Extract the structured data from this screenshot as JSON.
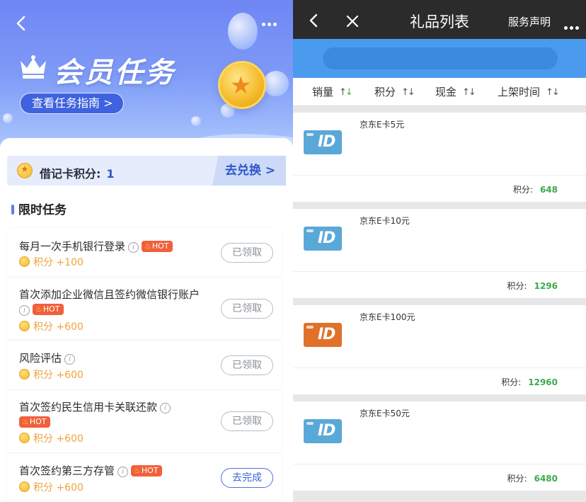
{
  "left": {
    "title": "会员任务",
    "guide_label": "查看任务指南 >",
    "points": {
      "label": "借记卡积分:",
      "value": "1",
      "exchange_label": "去兑换 >"
    },
    "section_title": "限时任务",
    "tasks": [
      {
        "name": "每月一次手机银行登录",
        "hot": "HOT",
        "reward": "积分 +100",
        "button": "已领取",
        "done": true
      },
      {
        "name": "首次添加企业微信且签约微信银行账户",
        "hot": "HOT",
        "reward": "积分 +600",
        "button": "已领取",
        "done": true
      },
      {
        "name": "风险评估",
        "hot": "",
        "reward": "积分 +600",
        "button": "已领取",
        "done": true
      },
      {
        "name": "首次签约民生信用卡关联还款",
        "hot": "HOT",
        "reward": "积分 +600",
        "button": "已领取",
        "done": true
      },
      {
        "name": "首次签约第三方存管",
        "hot": "HOT",
        "reward": "积分 +600",
        "button": "去完成",
        "done": false
      }
    ],
    "colors": {
      "accent": "#3f63de",
      "hot": "#f0603a",
      "reward": "#f0a23a"
    }
  },
  "right": {
    "title": "礼品列表",
    "declaration": "服务声明",
    "sort": [
      "销量",
      "积分",
      "现金",
      "上架时间"
    ],
    "price_label": "积分:",
    "gifts": [
      {
        "name": "京东E卡5元",
        "points": "648",
        "card_color": "#5aa8d8"
      },
      {
        "name": "京东E卡10元",
        "points": "1296",
        "card_color": "#5aa8d8"
      },
      {
        "name": "京东E卡100元",
        "points": "12960",
        "card_color": "#e0702a"
      },
      {
        "name": "京东E卡50元",
        "points": "6480",
        "card_color": "#5aa8d8"
      }
    ],
    "colors": {
      "topbar": "#2b2b2c",
      "searchbar": "#4a9aee",
      "points": "#3ea84e"
    }
  }
}
